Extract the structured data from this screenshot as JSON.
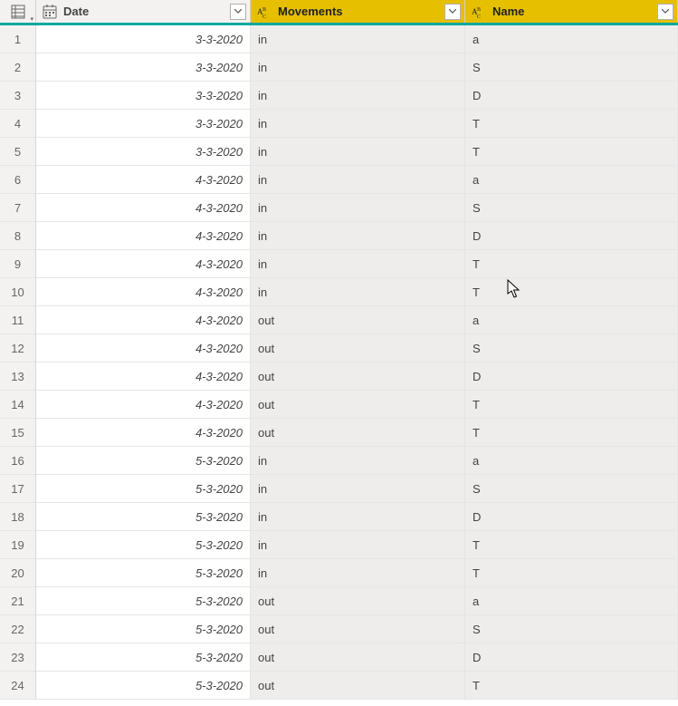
{
  "columns": {
    "date": {
      "label": "Date"
    },
    "movements": {
      "label": "Movements"
    },
    "name": {
      "label": "Name"
    }
  },
  "rows": [
    {
      "num": "1",
      "date": "3-3-2020",
      "movements": "in",
      "name": "a"
    },
    {
      "num": "2",
      "date": "3-3-2020",
      "movements": "in",
      "name": "S"
    },
    {
      "num": "3",
      "date": "3-3-2020",
      "movements": "in",
      "name": "D"
    },
    {
      "num": "4",
      "date": "3-3-2020",
      "movements": "in",
      "name": "T"
    },
    {
      "num": "5",
      "date": "3-3-2020",
      "movements": "in",
      "name": "T"
    },
    {
      "num": "6",
      "date": "4-3-2020",
      "movements": "in",
      "name": "a"
    },
    {
      "num": "7",
      "date": "4-3-2020",
      "movements": "in",
      "name": "S"
    },
    {
      "num": "8",
      "date": "4-3-2020",
      "movements": "in",
      "name": "D"
    },
    {
      "num": "9",
      "date": "4-3-2020",
      "movements": "in",
      "name": "T"
    },
    {
      "num": "10",
      "date": "4-3-2020",
      "movements": "in",
      "name": "T"
    },
    {
      "num": "11",
      "date": "4-3-2020",
      "movements": "out",
      "name": "a"
    },
    {
      "num": "12",
      "date": "4-3-2020",
      "movements": "out",
      "name": "S"
    },
    {
      "num": "13",
      "date": "4-3-2020",
      "movements": "out",
      "name": "D"
    },
    {
      "num": "14",
      "date": "4-3-2020",
      "movements": "out",
      "name": "T"
    },
    {
      "num": "15",
      "date": "4-3-2020",
      "movements": "out",
      "name": "T"
    },
    {
      "num": "16",
      "date": "5-3-2020",
      "movements": "in",
      "name": "a"
    },
    {
      "num": "17",
      "date": "5-3-2020",
      "movements": "in",
      "name": "S"
    },
    {
      "num": "18",
      "date": "5-3-2020",
      "movements": "in",
      "name": "D"
    },
    {
      "num": "19",
      "date": "5-3-2020",
      "movements": "in",
      "name": "T"
    },
    {
      "num": "20",
      "date": "5-3-2020",
      "movements": "in",
      "name": "T"
    },
    {
      "num": "21",
      "date": "5-3-2020",
      "movements": "out",
      "name": "a"
    },
    {
      "num": "22",
      "date": "5-3-2020",
      "movements": "out",
      "name": "S"
    },
    {
      "num": "23",
      "date": "5-3-2020",
      "movements": "out",
      "name": "D"
    },
    {
      "num": "24",
      "date": "5-3-2020",
      "movements": "out",
      "name": "T"
    }
  ]
}
